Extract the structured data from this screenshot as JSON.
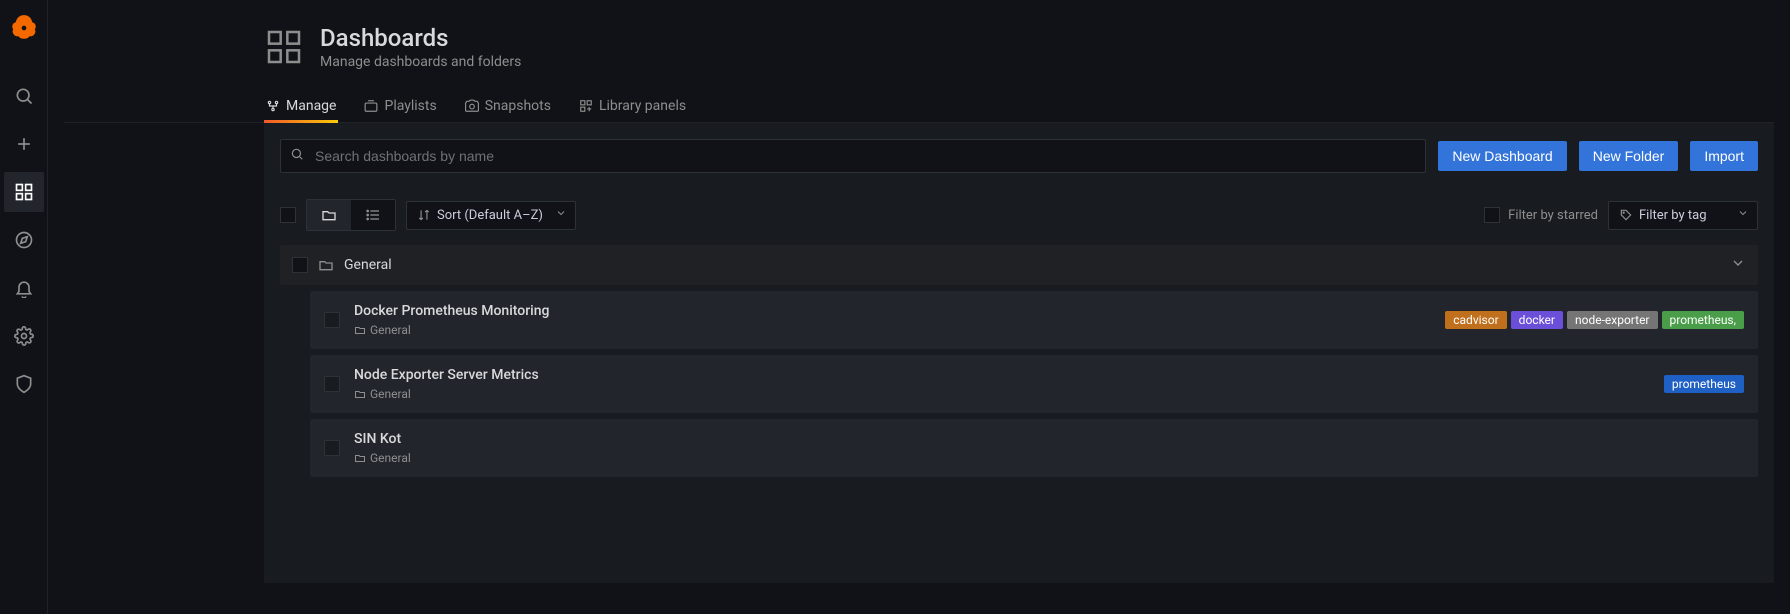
{
  "header": {
    "title": "Dashboards",
    "subtitle": "Manage dashboards and folders"
  },
  "tabs": [
    {
      "label": "Manage",
      "active": true
    },
    {
      "label": "Playlists",
      "active": false
    },
    {
      "label": "Snapshots",
      "active": false
    },
    {
      "label": "Library panels",
      "active": false
    }
  ],
  "search": {
    "placeholder": "Search dashboards by name"
  },
  "buttons": {
    "new_dashboard": "New Dashboard",
    "new_folder": "New Folder",
    "import": "Import"
  },
  "filters": {
    "sort_label": "Sort (Default A–Z)",
    "starred_label": "Filter by starred",
    "tag_label": "Filter by tag"
  },
  "folder": {
    "name": "General"
  },
  "dashboards": [
    {
      "title": "Docker Prometheus Monitoring",
      "folder": "General",
      "tags": [
        {
          "label": "cadvisor",
          "color": "#c06f1c"
        },
        {
          "label": "docker",
          "color": "#6c4fd8"
        },
        {
          "label": "node-exporter",
          "color": "#757575"
        },
        {
          "label": "prometheus,",
          "color": "#4a9e4a"
        }
      ]
    },
    {
      "title": "Node Exporter Server Metrics",
      "folder": "General",
      "tags": [
        {
          "label": "prometheus",
          "color": "#1f60c4"
        }
      ]
    },
    {
      "title": "SIN Kot",
      "folder": "General",
      "tags": []
    }
  ]
}
